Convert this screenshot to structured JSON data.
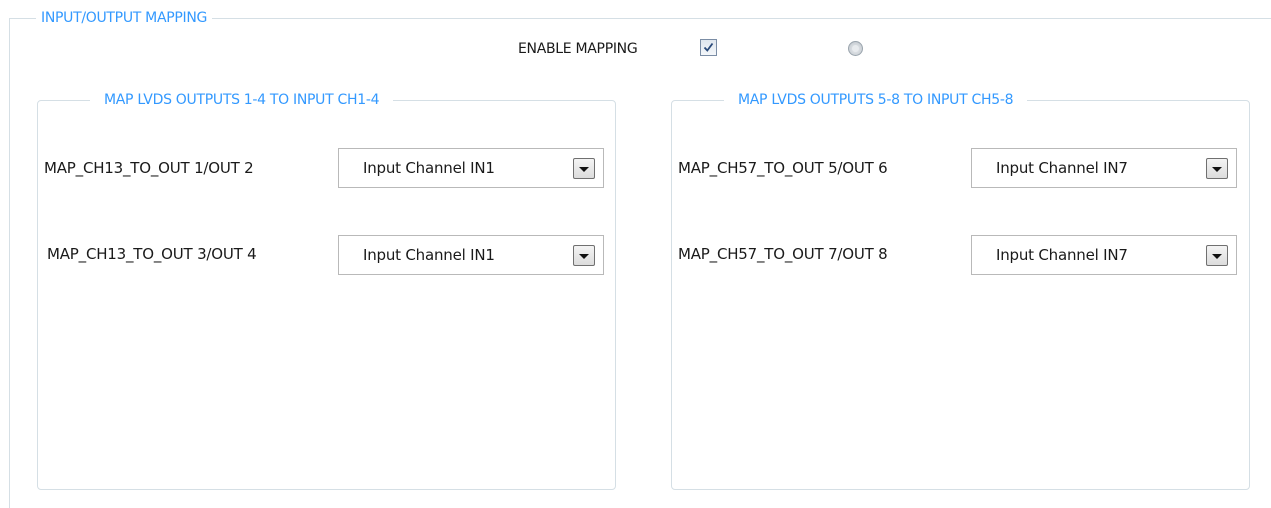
{
  "panel": {
    "title": "INPUT/OUTPUT MAPPING",
    "enable_label": "ENABLE MAPPING",
    "enable_checked": true,
    "status_indicator": "off"
  },
  "groups": [
    {
      "title": "MAP LVDS OUTPUTS 1-4 TO INPUT CH1-4",
      "rows": [
        {
          "label": "MAP_CH13_TO_OUT 1/OUT 2",
          "value": "Input Channel IN1"
        },
        {
          "label": "MAP_CH13_TO_OUT 3/OUT 4",
          "value": "Input Channel IN1"
        }
      ]
    },
    {
      "title": "MAP LVDS OUTPUTS 5-8 TO INPUT CH5-8",
      "rows": [
        {
          "label": "MAP_CH57_TO_OUT 5/OUT 6",
          "value": "Input Channel IN7"
        },
        {
          "label": "MAP_CH57_TO_OUT 7/OUT 8",
          "value": "Input Channel IN7"
        }
      ]
    }
  ],
  "colors": {
    "accent": "#3399ff",
    "border": "#d5dfe5"
  }
}
